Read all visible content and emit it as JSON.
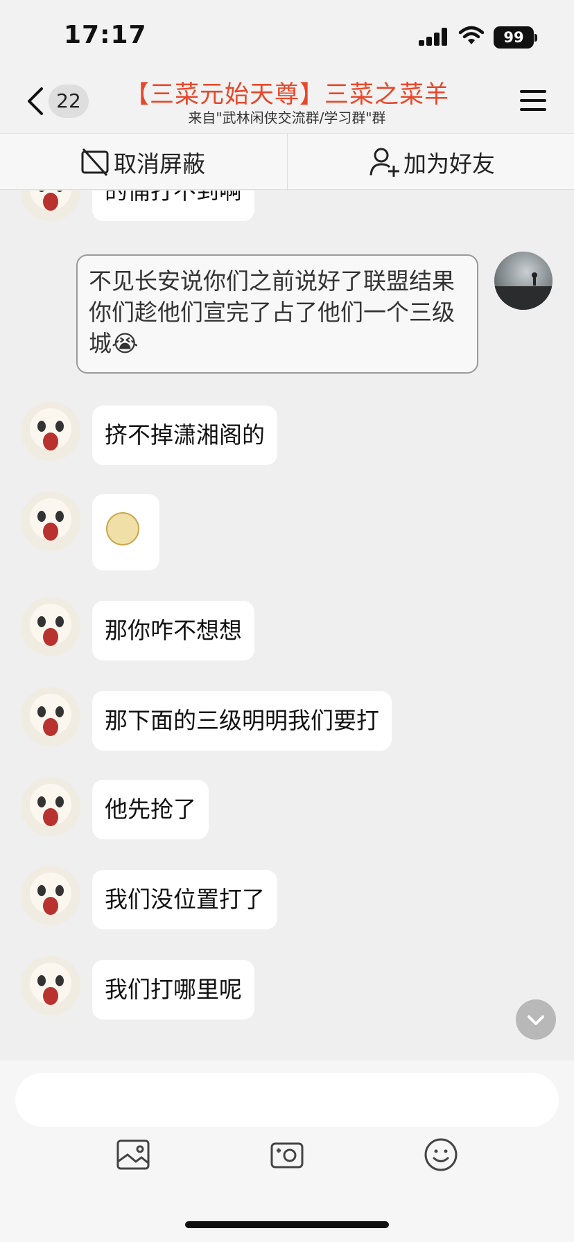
{
  "status_bar": {
    "time": "17:17",
    "battery": "99"
  },
  "header": {
    "back_count": "22",
    "title": "【三菜元始天尊】三菜之菜羊",
    "subtitle": "来自\"武林闲侠交流群/学习群\"群"
  },
  "actions": {
    "unblock_label": "取消屏蔽",
    "add_friend_label": "加为好友"
  },
  "messages": {
    "partial": "的俑打不到啊",
    "own": "不见长安说你们之前说好了联盟结果你们趁他们宣完了占了他们一个三级城😭",
    "m1": "挤不掉潇湘阁的",
    "m3": "那你咋不想想",
    "m4": "那下面的三级明明我们要打",
    "m5": "他先抢了",
    "m6": "我们没位置打了",
    "m7": "我们打哪里呢"
  },
  "input": {
    "value": "",
    "placeholder": ""
  },
  "icons": {
    "back": "chevron-left-icon",
    "menu": "hamburger-menu-icon",
    "unblock": "unblock-icon",
    "add_friend": "add-user-icon",
    "image": "image-icon",
    "camera": "camera-icon",
    "emoji": "smiley-icon",
    "scroll": "chevron-down-icon"
  },
  "colors": {
    "title": "#e8472a",
    "bubble": "#ffffff",
    "background": "#efefef"
  }
}
